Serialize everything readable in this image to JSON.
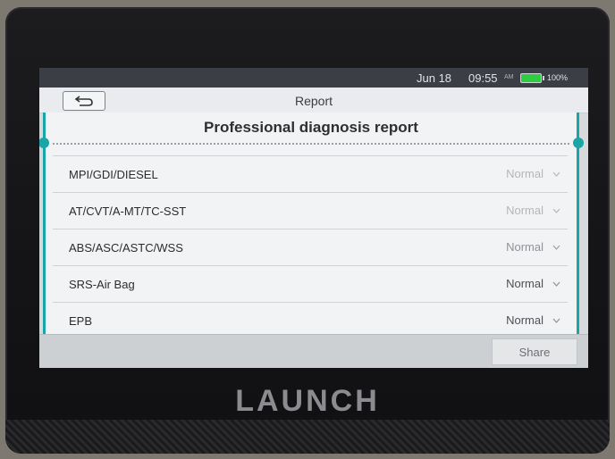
{
  "status_bar": {
    "date": "Jun 18",
    "time": "09:55",
    "ampm": "AM",
    "battery": "100%",
    "battery_color": "#2ecc40"
  },
  "title_bar": {
    "title": "Report",
    "back_icon": "back-arrow-icon"
  },
  "report": {
    "heading": "Professional diagnosis report",
    "systems": [
      {
        "name": "MPI/GDI/DIESEL",
        "status": "Normal"
      },
      {
        "name": "AT/CVT/A-MT/TC-SST",
        "status": "Normal"
      },
      {
        "name": "ABS/ASC/ASTC/WSS",
        "status": "Normal"
      },
      {
        "name": "SRS-Air Bag",
        "status": "Normal"
      },
      {
        "name": "EPB",
        "status": "Normal"
      }
    ]
  },
  "bottom_bar": {
    "share_label": "Share"
  },
  "device": {
    "brand": "LAUNCH"
  },
  "colors": {
    "accent": "#1aa6a9"
  }
}
